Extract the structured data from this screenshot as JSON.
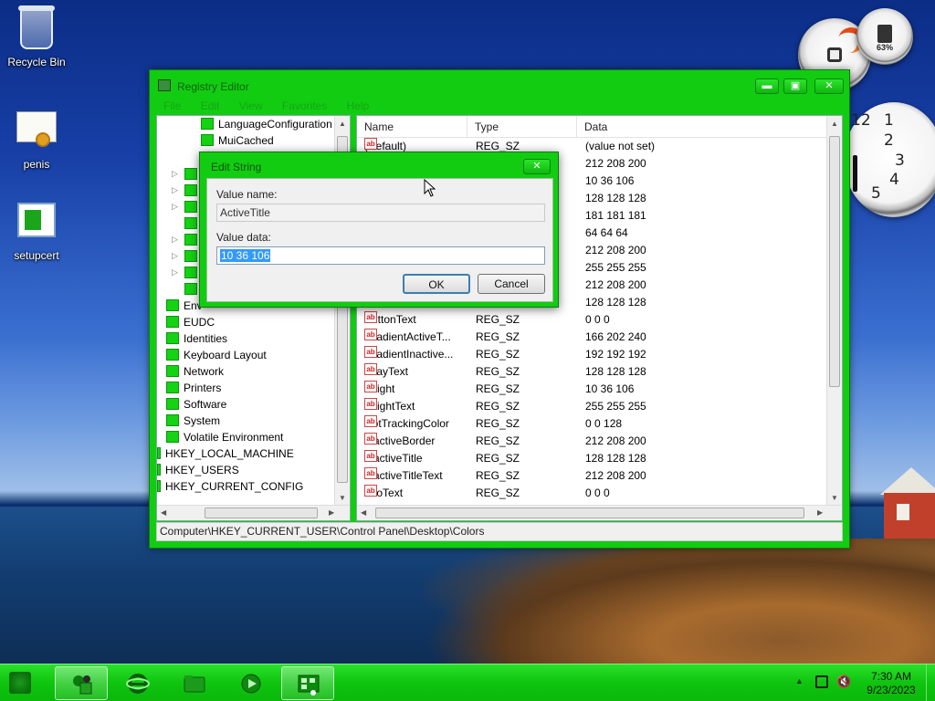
{
  "desktop": {
    "icons": [
      {
        "label": "Recycle Bin"
      },
      {
        "label": "penis"
      },
      {
        "label": "setupcert"
      }
    ],
    "gadgets": {
      "cpu_meter_percent": "63%",
      "clock_numbers": [
        "12",
        "1",
        "2",
        "3",
        "4",
        "5"
      ]
    }
  },
  "registry_window": {
    "title": "Registry Editor",
    "caption_buttons": {
      "minimize": "▬",
      "maximize": "▣",
      "close": "✕"
    },
    "menu": [
      "File",
      "Edit",
      "View",
      "Favorites",
      "Help"
    ],
    "tree": {
      "items": [
        {
          "label": "LanguageConfiguration"
        },
        {
          "label": "MuiCached"
        },
        {
          "label": "Env"
        },
        {
          "label": "EUDC"
        },
        {
          "label": "Identities"
        },
        {
          "label": "Keyboard Layout"
        },
        {
          "label": "Network"
        },
        {
          "label": "Printers"
        },
        {
          "label": "Software"
        },
        {
          "label": "System"
        },
        {
          "label": "Volatile Environment"
        },
        {
          "label": "HKEY_LOCAL_MACHINE"
        },
        {
          "label": "HKEY_USERS"
        },
        {
          "label": "HKEY_CURRENT_CONFIG"
        }
      ]
    },
    "list": {
      "columns": [
        "Name",
        "Type",
        "Data"
      ],
      "rows": [
        {
          "name": "(Default)",
          "type": "REG_SZ",
          "data": "(value not set)"
        },
        {
          "name": "",
          "type": "",
          "data": "212 208 200"
        },
        {
          "name": "",
          "type": "",
          "data": "10 36 106"
        },
        {
          "name": "",
          "type": "",
          "data": "128 128 128"
        },
        {
          "name": "",
          "type": "",
          "data": "181 181 181"
        },
        {
          "name": "",
          "type": "",
          "data": "64 64 64"
        },
        {
          "name": "",
          "type": "",
          "data": "212 208 200"
        },
        {
          "name": "",
          "type": "",
          "data": "255 255 255"
        },
        {
          "name": "",
          "type": "",
          "data": "212 208 200"
        },
        {
          "name": "",
          "type": "",
          "data": "128 128 128"
        },
        {
          "name": "ButtonText",
          "type": "REG_SZ",
          "data": "0 0 0"
        },
        {
          "name": "GradientActiveT...",
          "type": "REG_SZ",
          "data": "166 202 240"
        },
        {
          "name": "GradientInactive...",
          "type": "REG_SZ",
          "data": "192 192 192"
        },
        {
          "name": "GrayText",
          "type": "REG_SZ",
          "data": "128 128 128"
        },
        {
          "name": "Hilight",
          "type": "REG_SZ",
          "data": "10 36 106"
        },
        {
          "name": "HilightText",
          "type": "REG_SZ",
          "data": "255 255 255"
        },
        {
          "name": "HotTrackingColor",
          "type": "REG_SZ",
          "data": "0 0 128"
        },
        {
          "name": "InactiveBorder",
          "type": "REG_SZ",
          "data": "212 208 200"
        },
        {
          "name": "InactiveTitle",
          "type": "REG_SZ",
          "data": "128 128 128"
        },
        {
          "name": "InactiveTitleText",
          "type": "REG_SZ",
          "data": "212 208 200"
        },
        {
          "name": "InfoText",
          "type": "REG_SZ",
          "data": "0 0 0"
        }
      ]
    },
    "status_path": "Computer\\HKEY_CURRENT_USER\\Control Panel\\Desktop\\Colors"
  },
  "edit_dialog": {
    "title": "Edit String",
    "close": "✕",
    "value_name_label": "Value name:",
    "value_name": "ActiveTitle",
    "value_data_label": "Value data:",
    "value_data": "10 36 106",
    "ok_label": "OK",
    "cancel_label": "Cancel"
  },
  "taskbar": {
    "time": "7:30 AM",
    "date": "9/23/2023"
  },
  "colors": {
    "theme_green": "#12cc12",
    "selection_blue": "#3399ff"
  }
}
